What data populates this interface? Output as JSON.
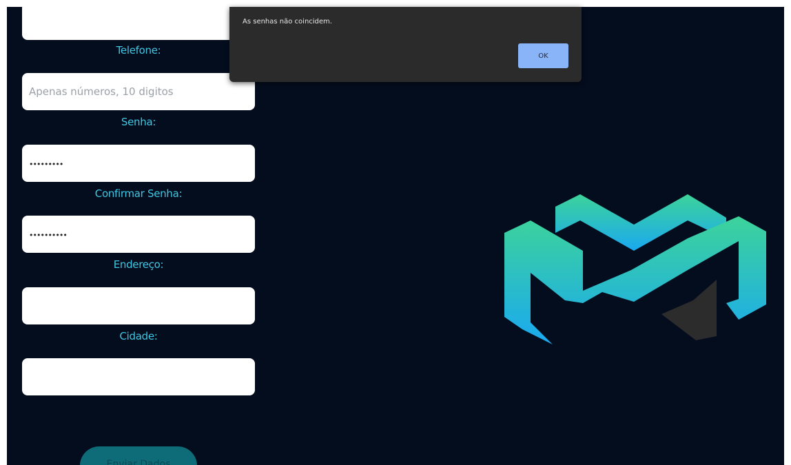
{
  "form": {
    "top_field_value": "",
    "phone_label": "Telefone:",
    "phone_placeholder": "Apenas números, 10 digitos",
    "password_label": "Senha:",
    "password_value": "•••••••••",
    "confirm_label": "Confirmar Senha:",
    "confirm_value": "••••••••••",
    "address_label": "Endereço:",
    "address_value": "",
    "city_label": "Cidade:",
    "city_value": "",
    "submit_label": "Enviar Dados"
  },
  "alert": {
    "message": "As senhas não coincidem.",
    "ok_label": "OK"
  },
  "colors": {
    "background": "#040d1e",
    "label": "#3ec8e4",
    "logo_gradient_top": "#3dd39a",
    "logo_gradient_bottom": "#1aa9f0",
    "dialog": "#2b2b2b",
    "dialog_button": "#8ab4f8"
  },
  "icons": {
    "logo": "m-logo-icon"
  }
}
